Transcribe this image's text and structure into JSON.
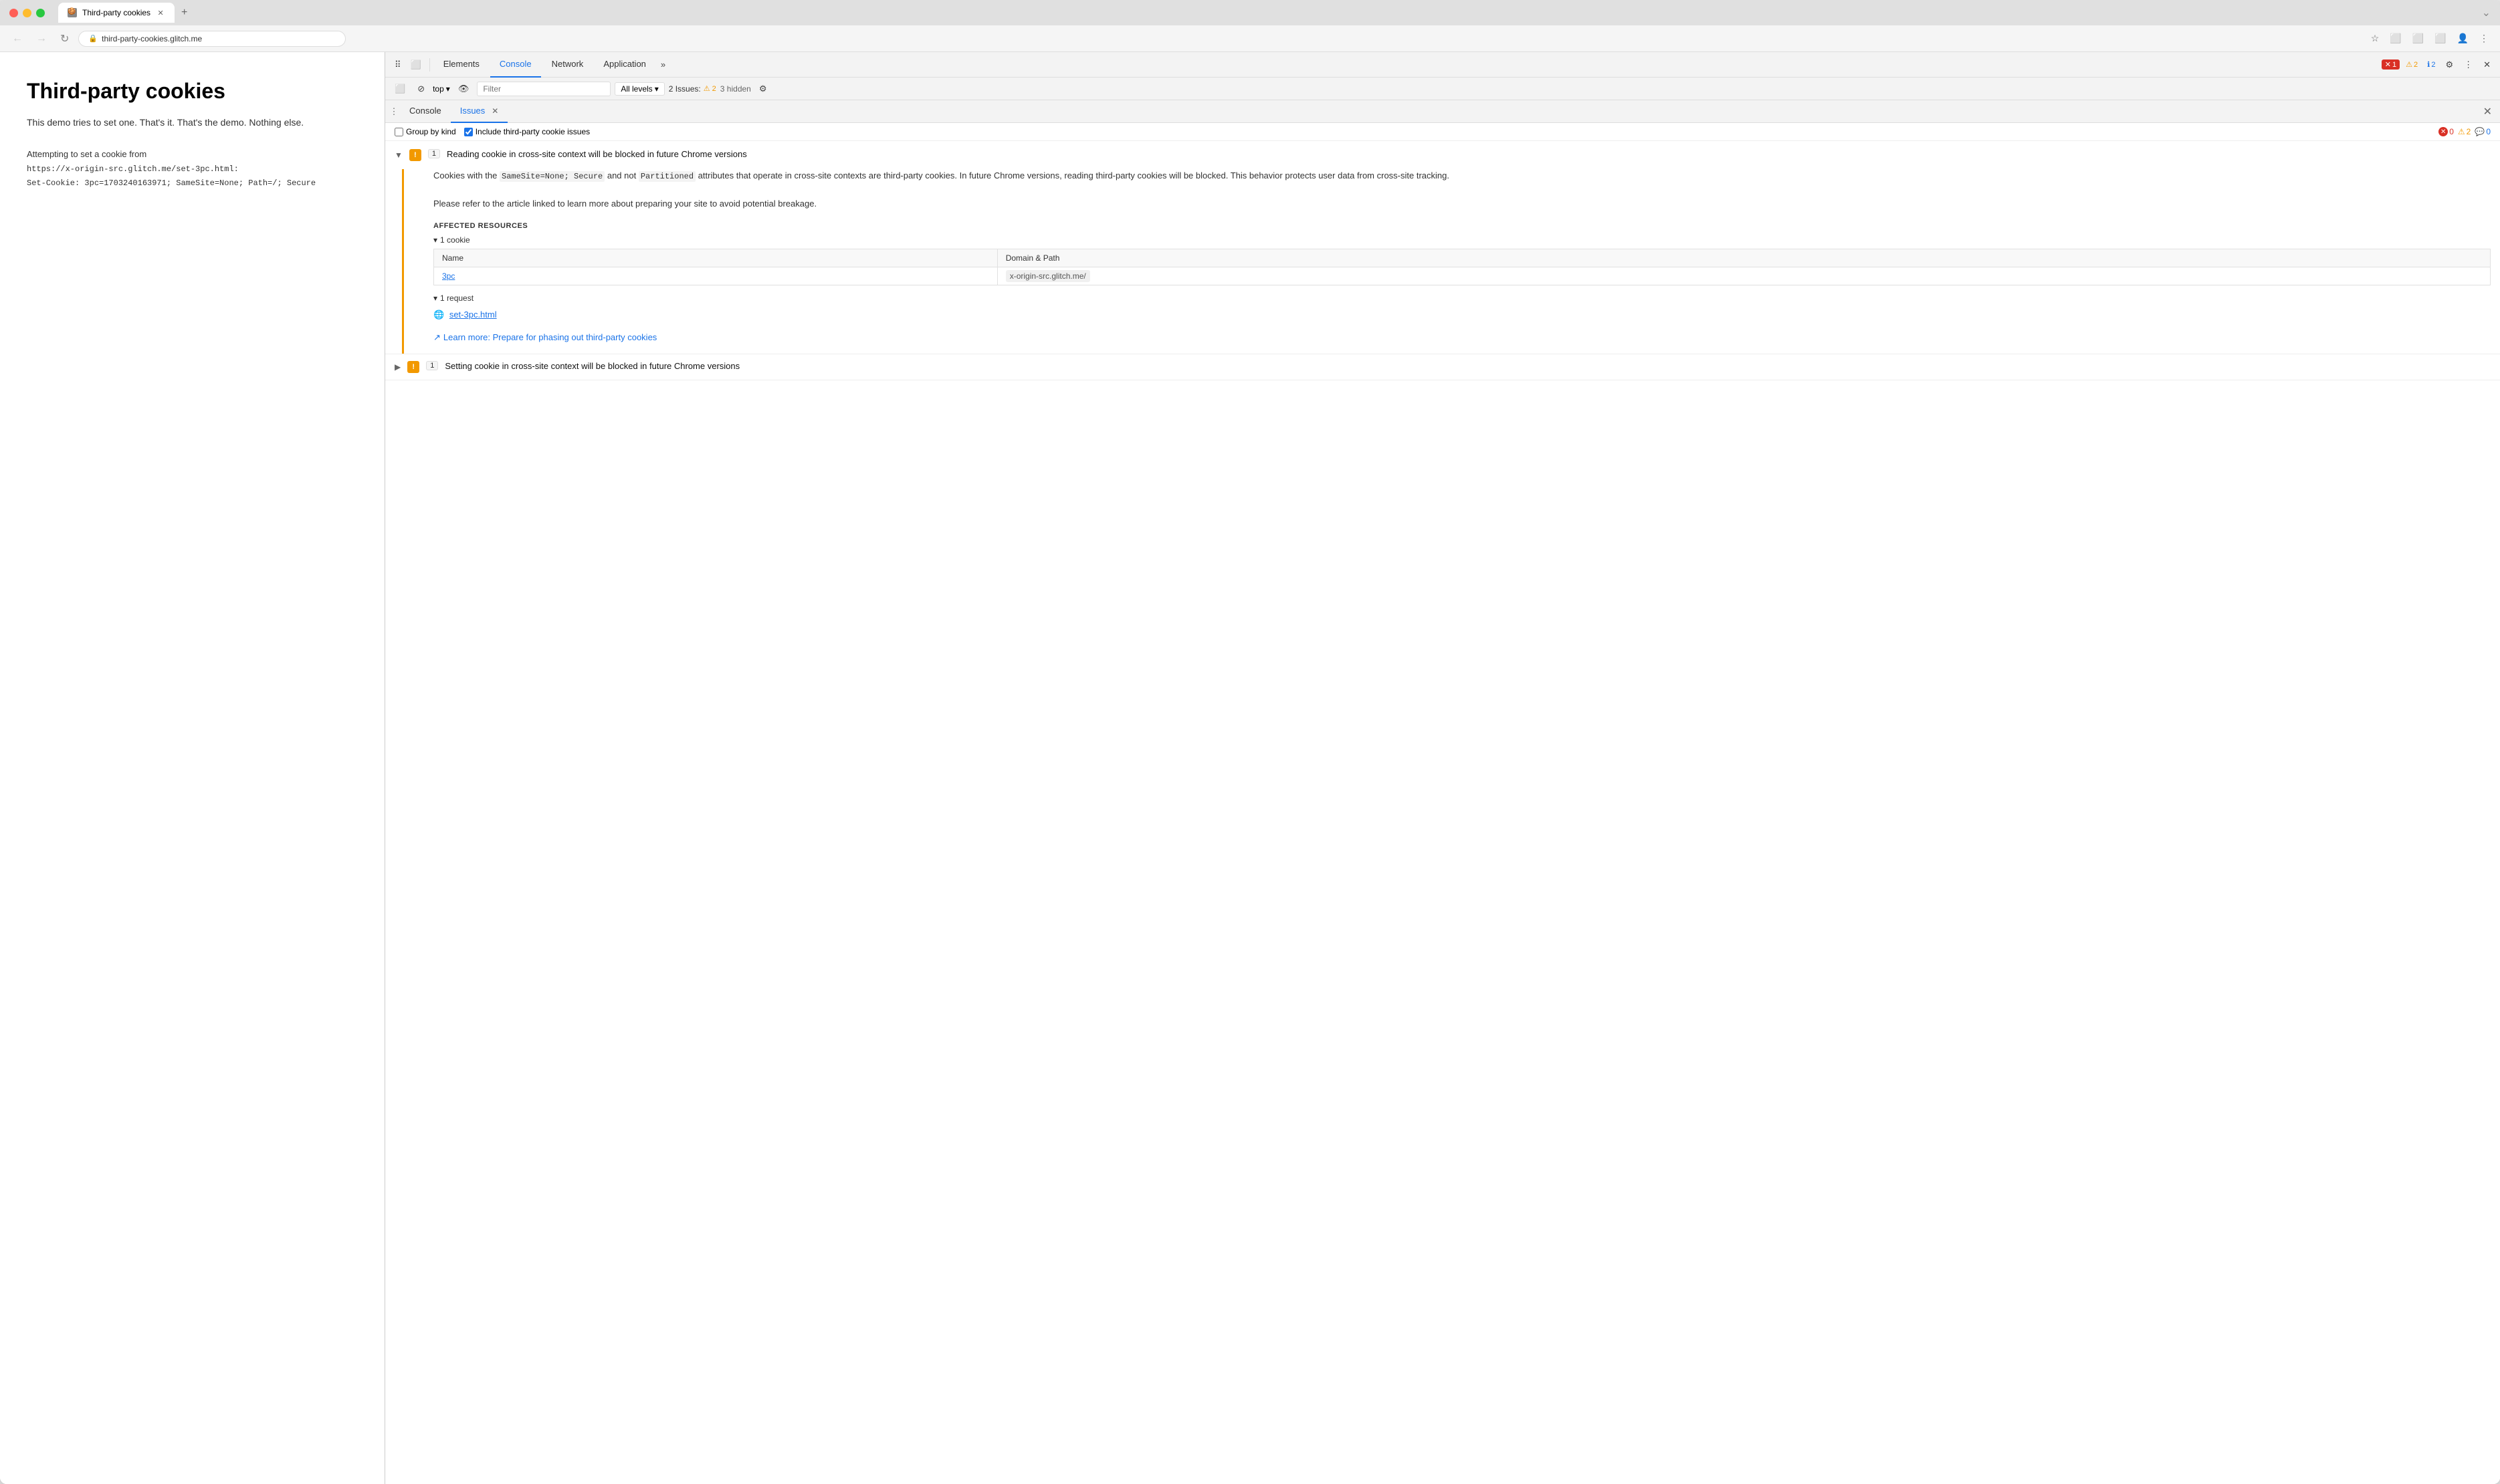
{
  "browser": {
    "tab_title": "Third-party cookies",
    "tab_favicon": "🍪",
    "new_tab_button": "+",
    "window_minimize": "—",
    "window_maximize": "❐",
    "window_close": "✕",
    "chevron_down": "⌄"
  },
  "navbar": {
    "back_button": "←",
    "forward_button": "→",
    "reload_button": "↻",
    "url": "third-party-cookies.glitch.me",
    "url_icon": "🔒",
    "search_icon": "🔍",
    "star_icon": "☆",
    "cast_icon": "⬜",
    "screenshot_icon": "⬜",
    "sidebar_icon": "⬜",
    "profile_icon": "👤",
    "menu_icon": "⋮"
  },
  "page": {
    "title": "Third-party cookies",
    "subtitle": "This demo tries to set one. That's it. That's the demo. Nothing else.",
    "body_label": "Attempting to set a cookie from",
    "cookie_url": "https://x-origin-src.glitch.me/set-3pc.html:",
    "cookie_value": "Set-Cookie: 3pc=1703240163971; SameSite=None; Path=/; Secure"
  },
  "devtools": {
    "toolbar": {
      "inspect_icon": "⠿",
      "device_icon": "⬜",
      "tabs": [
        "Elements",
        "Console",
        "Network",
        "Application"
      ],
      "active_tab": "Console",
      "more_icon": "»",
      "error_count": "1",
      "warn_count": "2",
      "info_count": "2",
      "settings_icon": "⚙",
      "menu_icon": "⋮",
      "close_icon": "✕"
    },
    "console_bar": {
      "sidebar_icon": "⬜",
      "block_icon": "⊘",
      "context_label": "top",
      "context_chevron": "▾",
      "eye_icon": "👁",
      "filter_placeholder": "Filter",
      "levels_label": "All levels",
      "levels_chevron": "▾",
      "issues_label": "2 Issues:",
      "issues_count": "2",
      "hidden_label": "3 hidden",
      "settings_icon": "⚙"
    },
    "issues_panel": {
      "menu_icon": "⋮",
      "tabs": [
        "Console",
        "Issues"
      ],
      "active_tab": "Issues",
      "close_icon": "✕",
      "group_by_kind_label": "Group by kind",
      "include_third_party_label": "Include third-party cookie issues",
      "include_third_party_checked": true,
      "error_count": "0",
      "warn_count": "2",
      "info_count": "0",
      "issues": [
        {
          "id": "issue-1",
          "expanded": true,
          "chevron": "▼",
          "count": "1",
          "title": "Reading cookie in cross-site context will be blocked in future Chrome versions",
          "description_parts": [
            "Cookies with the ",
            "SameSite=None; Secure",
            " and not ",
            "Partitioned",
            " attributes that operate in cross-site contexts are third-party cookies. In future Chrome versions, reading third-party cookies will be blocked. This behavior protects user data from cross-site tracking."
          ],
          "description_p2": "Please refer to the article linked to learn more about preparing your site to avoid potential breakage.",
          "affected_title": "AFFECTED RESOURCES",
          "cookie_group": {
            "header": "▾ 1 cookie",
            "table_headers": [
              "Name",
              "Domain & Path"
            ],
            "rows": [
              {
                "name": "3pc",
                "domain": "x-origin-src.glitch.me/"
              }
            ]
          },
          "request_group": {
            "header": "▾ 1 request",
            "rows": [
              {
                "url": "set-3pc.html",
                "icon": "🌐"
              }
            ]
          },
          "learn_more_text": "Learn more: Prepare for phasing out third-party cookies",
          "learn_more_url": "#"
        },
        {
          "id": "issue-2",
          "expanded": false,
          "chevron": "▶",
          "count": "1",
          "title": "Setting cookie in cross-site context will be blocked in future Chrome versions"
        }
      ]
    }
  }
}
